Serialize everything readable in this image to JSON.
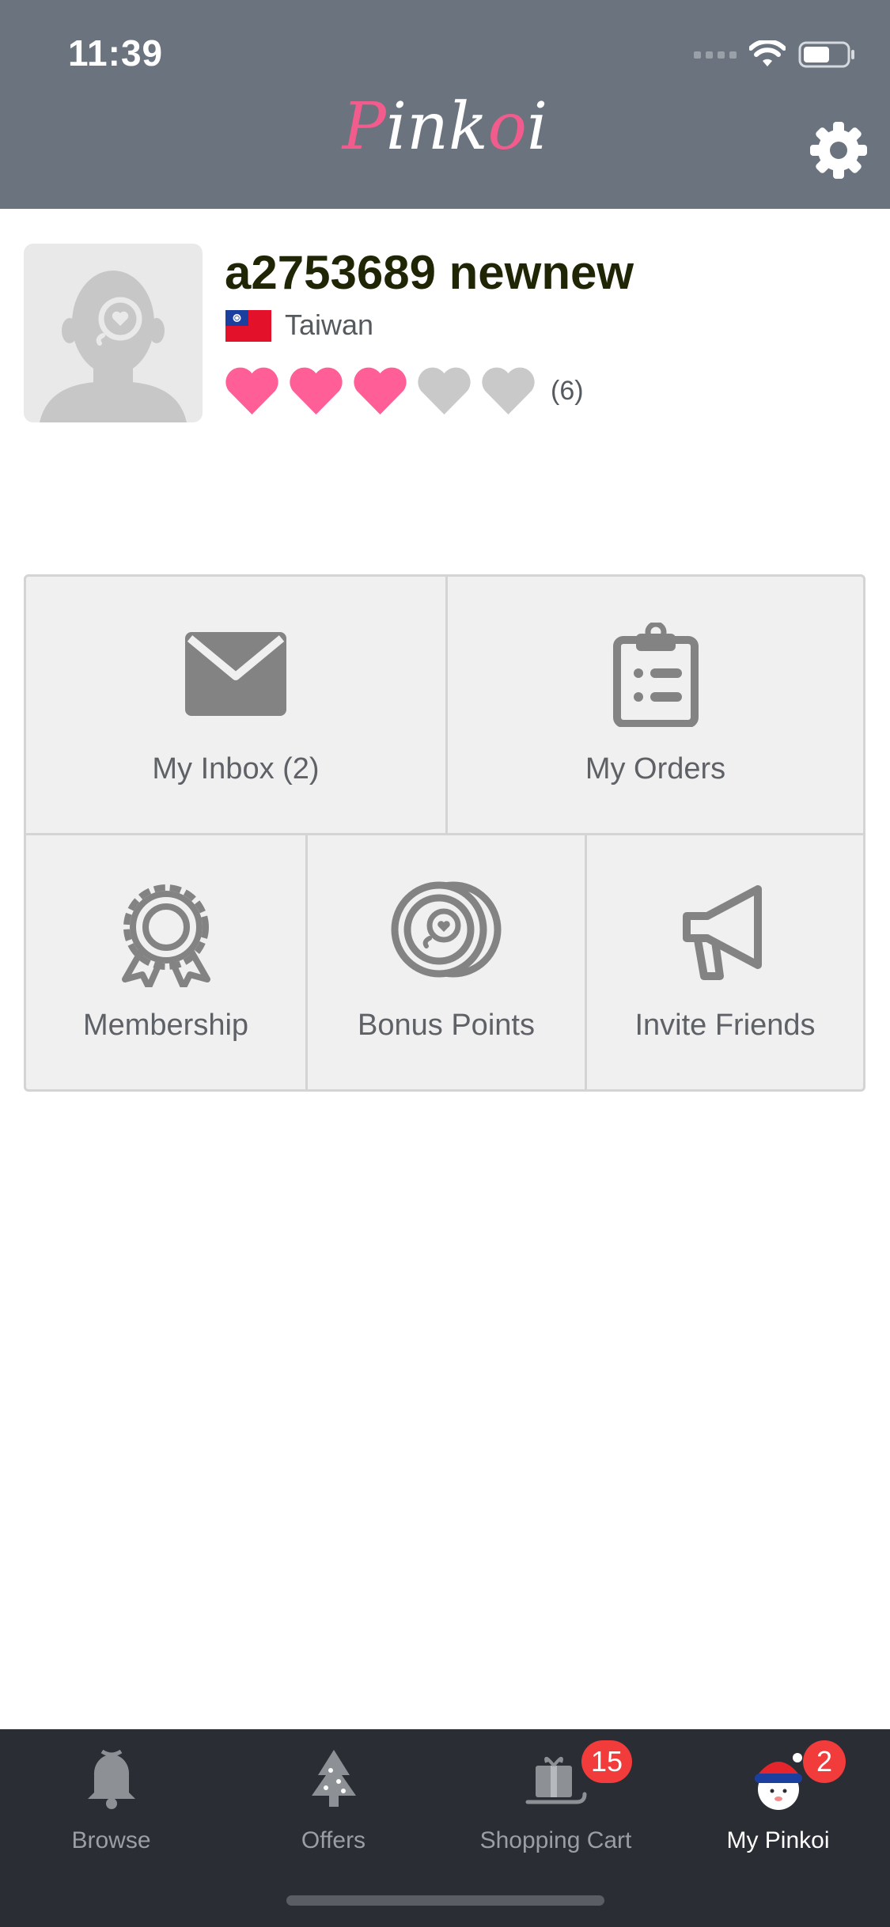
{
  "status_bar": {
    "time": "11:39"
  },
  "header": {
    "logo_text_1": "P",
    "logo_text_2": "ink",
    "logo_text_3": "o",
    "logo_text_4": "i",
    "settings_icon": "gear-icon"
  },
  "profile": {
    "username": "a2753689 newnew",
    "country": "Taiwan",
    "rating_filled": 3,
    "rating_total": 5,
    "rating_count": "(6)"
  },
  "menu": {
    "inbox_label": "My Inbox (2)",
    "orders_label": "My Orders",
    "membership_label": "Membership",
    "bonus_label": "Bonus Points",
    "invite_label": "Invite Friends"
  },
  "tabs": {
    "browse": "Browse",
    "offers": "Offers",
    "cart": "Shopping Cart",
    "cart_badge": "15",
    "my_pinkoi": "My Pinkoi",
    "my_pinkoi_badge": "2"
  },
  "colors": {
    "header_bg": "#6b737e",
    "brand_pink": "#f25c8c",
    "heart_filled": "#ff5e97",
    "heart_empty": "#c9c9c9",
    "tabbar_bg": "#2a2d33",
    "badge": "#f23b3b"
  }
}
